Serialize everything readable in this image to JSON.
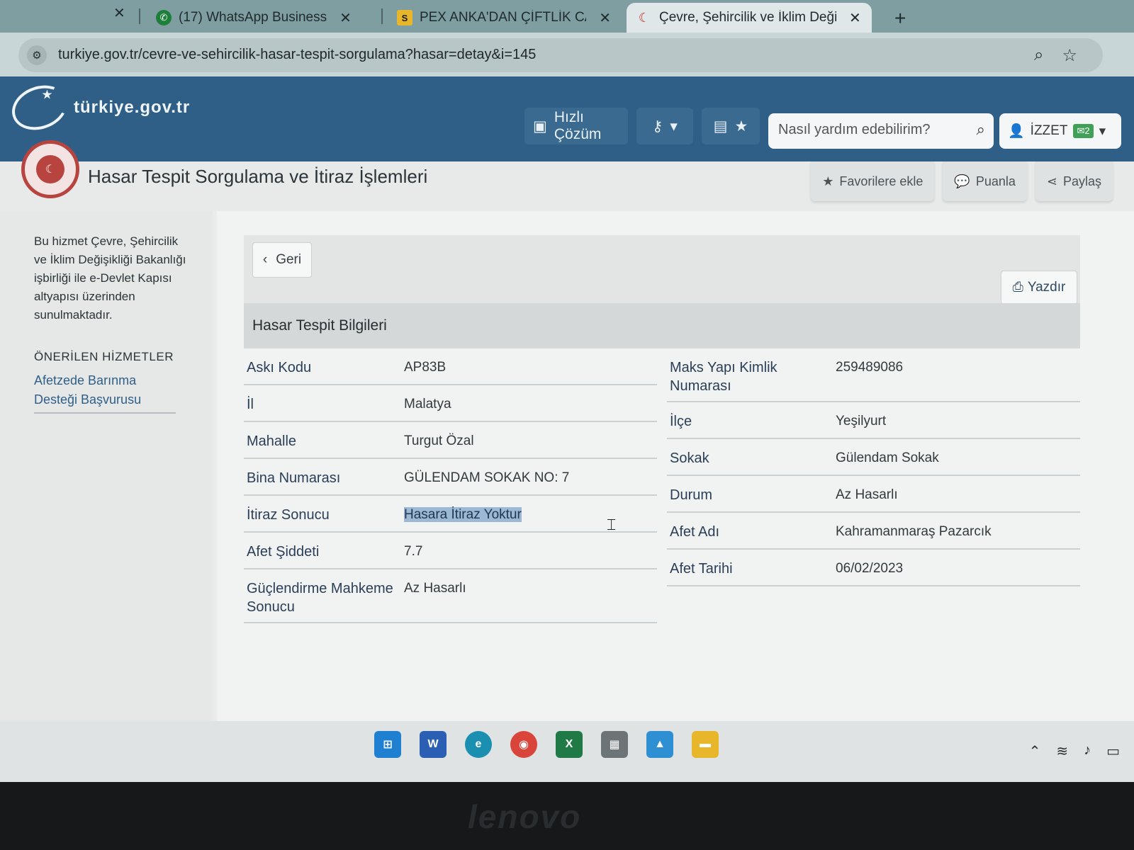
{
  "browser": {
    "tabs": [
      {
        "label": "(17) WhatsApp Business",
        "icon": "whatsapp-icon"
      },
      {
        "label": "PEX ANKA'DAN ÇİFTLİK CADDE",
        "icon": "s-site-icon"
      },
      {
        "label": "Çevre, Şehircilik ve İklim Değişil",
        "icon": "turkiye-gov-icon"
      }
    ],
    "url": "turkiye.gov.tr/cevre-ve-sehircilik-hasar-tespit-sorgulama?hasar=detay&i=145"
  },
  "site": {
    "logo_text": "türkiye.gov.tr",
    "quick_solution": "Hızlı Çözüm",
    "search_placeholder": "Nasıl yardım edebilirim?",
    "user_name": "İZZET",
    "message_count": "2"
  },
  "page": {
    "title": "Hasar Tespit Sorgulama ve İtiraz İşlemleri",
    "actions": {
      "favorite": "Favorilere ekle",
      "rate": "Puanla",
      "share": "Paylaş"
    }
  },
  "sidebar": {
    "info": "Bu hizmet Çevre, Şehircilik ve İklim Değişikliği Bakanlığı işbirliği ile e-Devlet Kapısı altyapısı üzerinden sunulmaktadır.",
    "suggested_heading": "ÖNERİLEN HİZMETLER",
    "suggested_link": "Afetzede Barınma Desteği Başvurusu"
  },
  "main": {
    "back_label": "Geri",
    "print_label": "Yazdır",
    "section_title": "Hasar Tespit Bilgileri",
    "left_fields": [
      {
        "label": "Askı Kodu",
        "value": "AP83B"
      },
      {
        "label": "İl",
        "value": "Malatya"
      },
      {
        "label": "Mahalle",
        "value": "Turgut Özal"
      },
      {
        "label": "Bina Numarası",
        "value": "GÜLENDAM SOKAK NO: 7"
      },
      {
        "label": "İtiraz Sonucu",
        "value": "Hasara İtiraz Yoktur"
      },
      {
        "label": "Afet Şiddeti",
        "value": "7.7"
      },
      {
        "label": "Güçlendirme Mahkeme Sonucu",
        "value": "Az Hasarlı"
      }
    ],
    "right_fields": [
      {
        "label": "Maks Yapı Kimlik Numarası",
        "value": "259489086"
      },
      {
        "label": "İlçe",
        "value": "Yeşilyurt"
      },
      {
        "label": "Sokak",
        "value": "Gülendam Sokak"
      },
      {
        "label": "Durum",
        "value": "Az Hasarlı"
      },
      {
        "label": "Afet Adı",
        "value": "Kahramanmaraş Pazarcık"
      },
      {
        "label": "Afet Tarihi",
        "value": "06/02/2023"
      }
    ]
  },
  "laptop_brand": "lenovo"
}
